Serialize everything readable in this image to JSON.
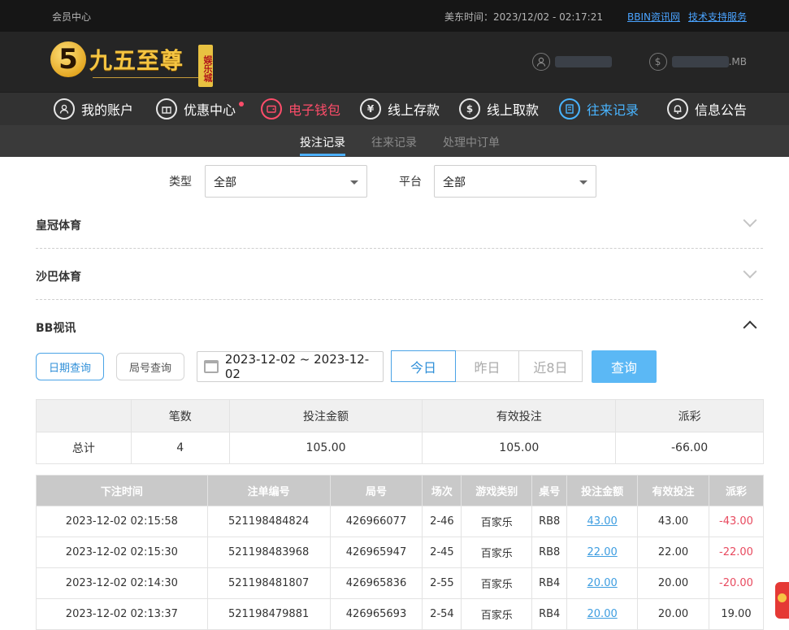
{
  "topbar": {
    "member_center": "会员中心",
    "time_label": "美东时间：",
    "time_value": "2023/12/02 - 02:17:21",
    "link_news": "BBIN资讯网",
    "link_support": "技术支持服务"
  },
  "logo": {
    "numeral": "5",
    "name": "九五至尊",
    "badge": "娱乐城"
  },
  "user": {
    "balance_suffix": ".MB"
  },
  "nav": {
    "items": [
      {
        "label": "我的账户",
        "icon": "user-icon"
      },
      {
        "label": "优惠中心",
        "icon": "gift-icon"
      },
      {
        "label": "电子钱包",
        "icon": "wallet-icon"
      },
      {
        "label": "线上存款",
        "icon": "deposit-icon"
      },
      {
        "label": "线上取款",
        "icon": "withdraw-icon"
      },
      {
        "label": "往来记录",
        "icon": "records-icon"
      },
      {
        "label": "信息公告",
        "icon": "bell-icon"
      }
    ]
  },
  "subnav": {
    "tabs": [
      "投注记录",
      "往来记录",
      "处理中订单"
    ]
  },
  "filters": {
    "type_label": "类型",
    "type_value": "全部",
    "platform_label": "平台",
    "platform_value": "全部"
  },
  "sections": [
    "皇冠体育",
    "沙巴体育",
    "BB视讯"
  ],
  "query": {
    "date_query": "日期查询",
    "round_query": "局号查询",
    "date_range": "2023-12-02 ~ 2023-12-02",
    "today": "今日",
    "yesterday": "昨日",
    "last8": "近8日",
    "search": "查询"
  },
  "summary": {
    "headers": [
      "",
      "笔数",
      "投注金额",
      "有效投注",
      "派彩"
    ],
    "row": [
      "总计",
      "4",
      "105.00",
      "105.00",
      "-66.00"
    ]
  },
  "details": {
    "headers": [
      "下注时间",
      "注单编号",
      "局号",
      "场次",
      "游戏类别",
      "桌号",
      "投注金额",
      "有效投注",
      "派彩"
    ],
    "rows": [
      [
        "2023-12-02 02:15:58",
        "521198484824",
        "426966077",
        "2-46",
        "百家乐",
        "RB8",
        "43.00",
        "43.00",
        "-43.00"
      ],
      [
        "2023-12-02 02:15:30",
        "521198483968",
        "426965947",
        "2-45",
        "百家乐",
        "RB8",
        "22.00",
        "22.00",
        "-22.00"
      ],
      [
        "2023-12-02 02:14:30",
        "521198481807",
        "426965836",
        "2-55",
        "百家乐",
        "RB4",
        "20.00",
        "20.00",
        "-20.00"
      ],
      [
        "2023-12-02 02:13:37",
        "521198479881",
        "426965693",
        "2-54",
        "百家乐",
        "RB4",
        "20.00",
        "20.00",
        "19.00"
      ]
    ]
  },
  "colors": {
    "accent": "#4aa3e6",
    "negative": "#e84a5f",
    "nav_red": "#ff4d6a",
    "nav_blue": "#49b4ff"
  }
}
